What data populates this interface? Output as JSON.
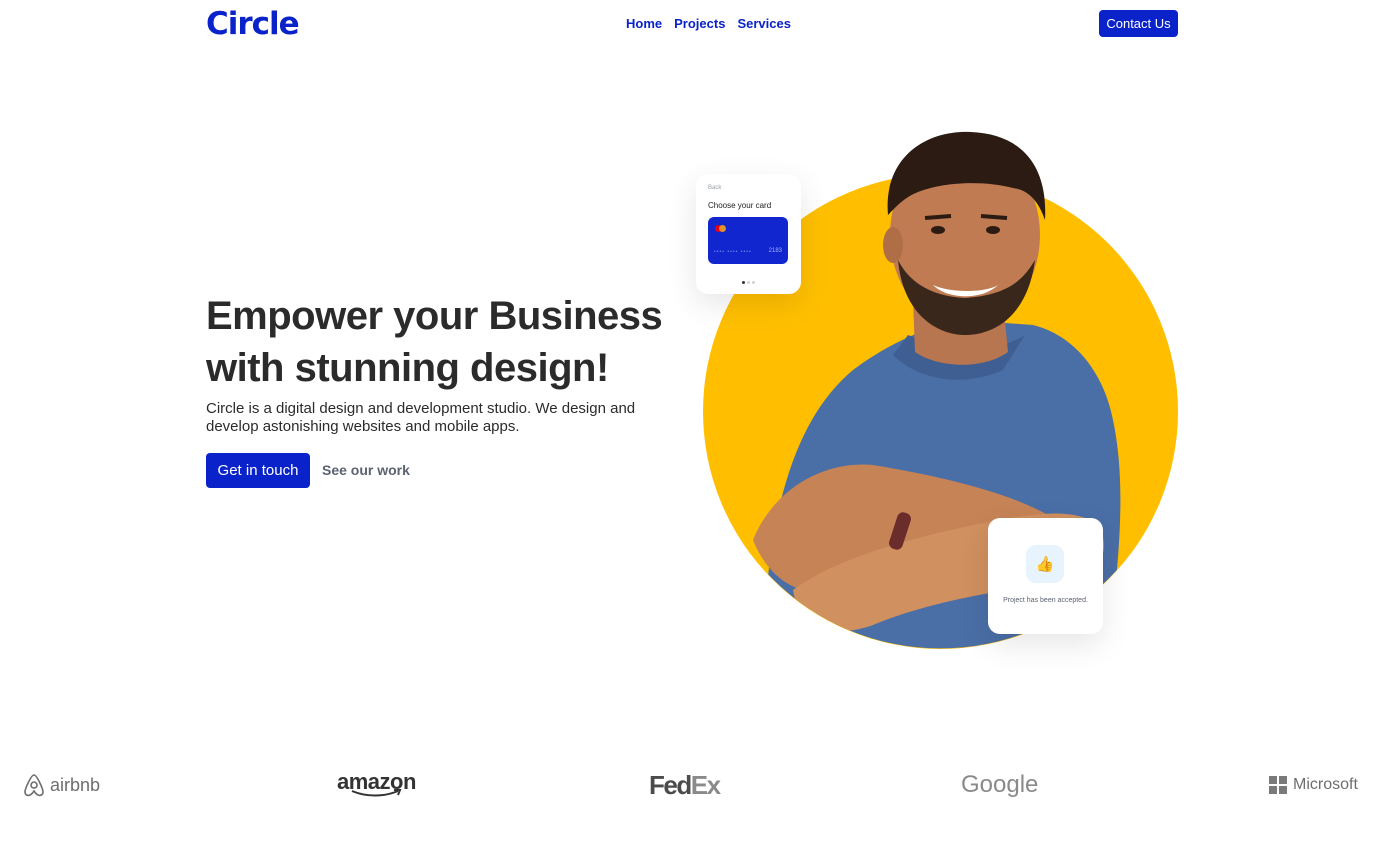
{
  "header": {
    "logo": "Circle",
    "nav": [
      "Home",
      "Projects",
      "Services"
    ],
    "contact_label": "Contact Us"
  },
  "hero": {
    "title": "Empower your Business with stunning design!",
    "subtitle": "Circle is a digital design and development studio. We design and develop astonishing websites and mobile apps.",
    "primary_cta": "Get in touch",
    "secondary_cta": "See our work"
  },
  "illustration": {
    "circle_color": "#ffbf00",
    "card_top": {
      "back_label": "Back",
      "title": "Choose your card",
      "card_dots": "•••• •••• ••••",
      "card_last4": "2183"
    },
    "card_bottom": {
      "icon": "thumbs-up-icon",
      "message": "Project has been accepted."
    }
  },
  "brands": {
    "airbnb": "airbnb",
    "amazon": "amazon",
    "fedex_fe": "Fed",
    "fedex_ex": "Ex",
    "google": "Google",
    "microsoft": "Microsoft"
  },
  "colors": {
    "brand_blue": "#0a22c9",
    "accent_yellow": "#ffbf00",
    "text_dark": "#2b2b2b",
    "muted": "#5b6270"
  }
}
